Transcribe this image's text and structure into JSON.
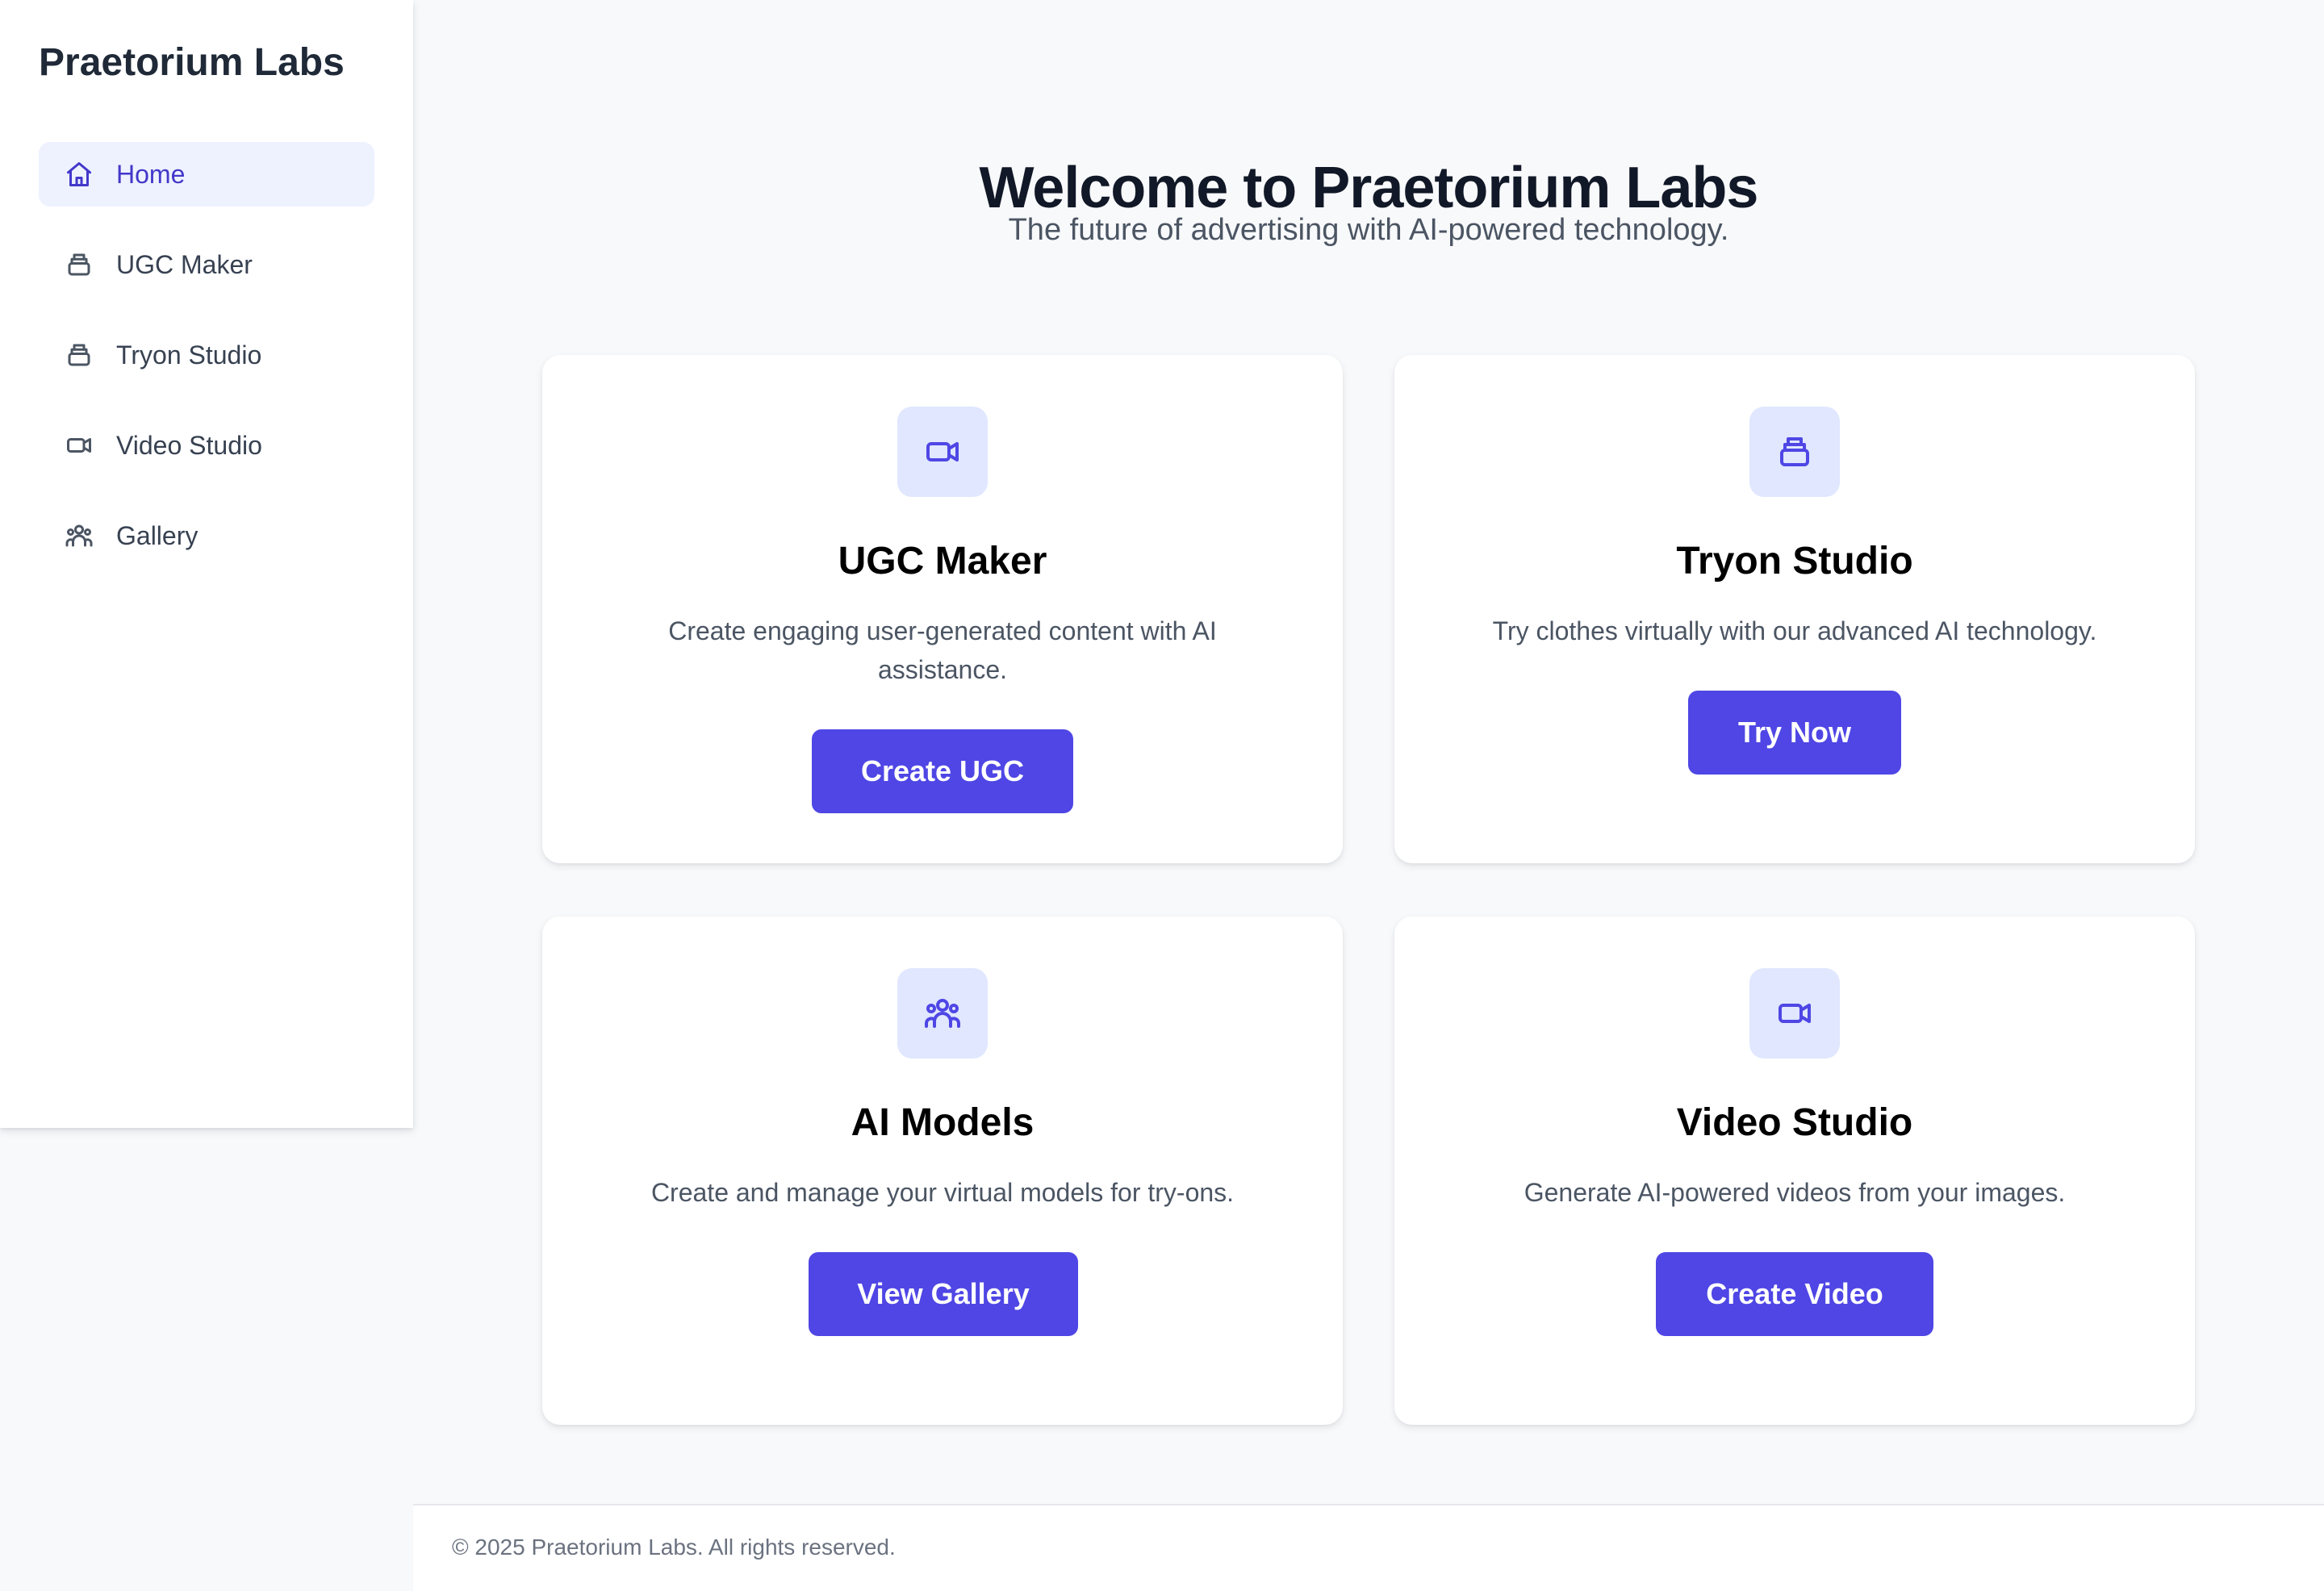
{
  "app": {
    "brand": "Praetorium Labs"
  },
  "sidebar": {
    "items": [
      {
        "label": "Home",
        "icon": "home-icon",
        "active": true
      },
      {
        "label": "UGC Maker",
        "icon": "stack-icon",
        "active": false
      },
      {
        "label": "Tryon Studio",
        "icon": "stack-icon",
        "active": false
      },
      {
        "label": "Video Studio",
        "icon": "video-camera-icon",
        "active": false
      },
      {
        "label": "Gallery",
        "icon": "people-group-icon",
        "active": false
      }
    ]
  },
  "hero": {
    "title": "Welcome to Praetorium Labs",
    "subtitle": "The future of advertising with AI-powered technology."
  },
  "cards": [
    {
      "icon": "video-camera-icon",
      "title": "UGC Maker",
      "description": "Create engaging user-generated content with AI assistance.",
      "button": "Create UGC"
    },
    {
      "icon": "stack-icon",
      "title": "Tryon Studio",
      "description": "Try clothes virtually with our advanced AI technology.",
      "button": "Try Now"
    },
    {
      "icon": "people-group-icon",
      "title": "AI Models",
      "description": "Create and manage your virtual models for try-ons.",
      "button": "View Gallery"
    },
    {
      "icon": "video-camera-icon",
      "title": "Video Studio",
      "description": "Generate AI-powered videos from your images.",
      "button": "Create Video"
    }
  ],
  "footer": {
    "text": "© 2025 Praetorium Labs. All rights reserved."
  },
  "colors": {
    "accent": "#4f46e5",
    "accent_soft": "#e0e7ff",
    "active_nav_bg": "#eef2ff",
    "page_bg": "#f8f9fb"
  }
}
